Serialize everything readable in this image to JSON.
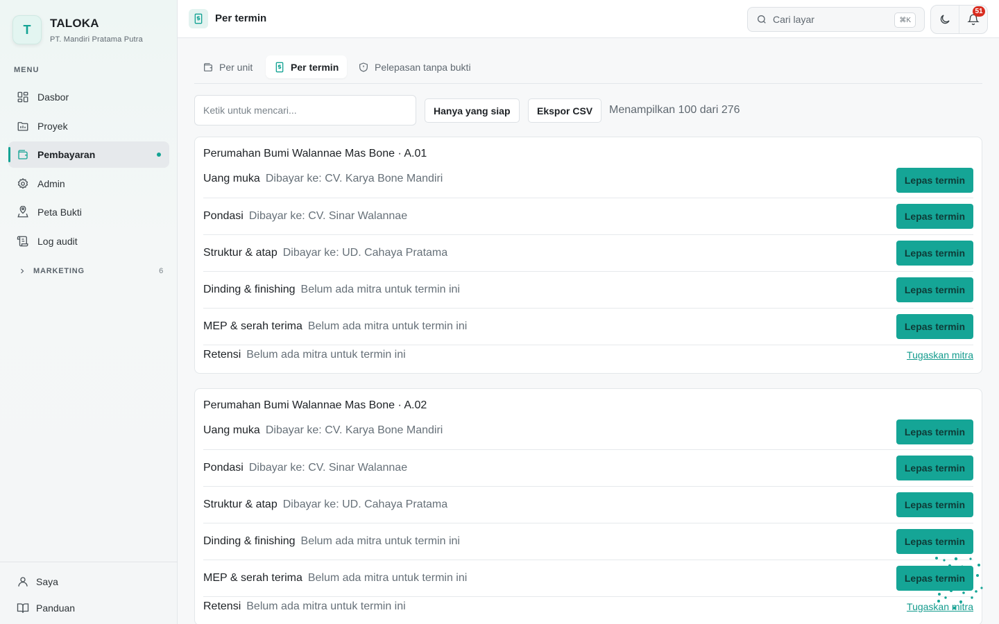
{
  "brand": {
    "logo_letter": "T",
    "name": "TALOKA",
    "company": "PT. Mandiri Pratama Putra"
  },
  "sidebar": {
    "menu_label": "MENU",
    "items": [
      {
        "label": "Dasbor",
        "icon": "dashboard-icon"
      },
      {
        "label": "Proyek",
        "icon": "folder-icon"
      },
      {
        "label": "Pembayaran",
        "icon": "wallet-icon",
        "active": true
      },
      {
        "label": "Admin",
        "icon": "gear-icon"
      },
      {
        "label": "Peta Bukti",
        "icon": "map-pin-icon"
      },
      {
        "label": "Log audit",
        "icon": "scroll-icon"
      }
    ],
    "marketing": {
      "label": "MARKETING",
      "count": "6"
    },
    "footer": [
      {
        "label": "Saya",
        "icon": "user-icon"
      },
      {
        "label": "Panduan",
        "icon": "book-icon"
      }
    ]
  },
  "header": {
    "title": "Per termin",
    "search_placeholder": "Cari layar",
    "shortcut": "⌘K",
    "notification_count": "51"
  },
  "tabs": [
    {
      "label": "Per unit",
      "icon": "wallet-icon"
    },
    {
      "label": "Per termin",
      "icon": "receipt-icon",
      "active": true
    },
    {
      "label": "Pelepasan tanpa bukti",
      "icon": "shield-icon"
    }
  ],
  "toolbar": {
    "search_placeholder": "Ketik untuk mencari...",
    "ready_only_label": "Hanya yang siap",
    "export_label": "Ekspor CSV",
    "showing_text": "Menampilkan 100 dari 276"
  },
  "actions": {
    "release_label": "Lepas termin",
    "assign_label": "Tugaskan mitra"
  },
  "units": [
    {
      "title": "Perumahan Bumi Walannae Mas Bone · A.01",
      "terms": [
        {
          "name": "Uang muka",
          "payee": "Dibayar ke: CV. Karya Bone Mandiri",
          "action": "release"
        },
        {
          "name": "Pondasi",
          "payee": "Dibayar ke: CV. Sinar Walannae",
          "action": "release"
        },
        {
          "name": "Struktur & atap",
          "payee": "Dibayar ke: UD. Cahaya Pratama",
          "action": "release"
        },
        {
          "name": "Dinding & finishing",
          "payee": "Belum ada mitra untuk termin ini",
          "action": "release"
        },
        {
          "name": "MEP & serah terima",
          "payee": "Belum ada mitra untuk termin ini",
          "action": "release"
        },
        {
          "name": "Retensi",
          "payee": "Belum ada mitra untuk termin ini",
          "action": "assign"
        }
      ]
    },
    {
      "title": "Perumahan Bumi Walannae Mas Bone · A.02",
      "terms": [
        {
          "name": "Uang muka",
          "payee": "Dibayar ke: CV. Karya Bone Mandiri",
          "action": "release"
        },
        {
          "name": "Pondasi",
          "payee": "Dibayar ke: CV. Sinar Walannae",
          "action": "release"
        },
        {
          "name": "Struktur & atap",
          "payee": "Dibayar ke: UD. Cahaya Pratama",
          "action": "release"
        },
        {
          "name": "Dinding & finishing",
          "payee": "Belum ada mitra untuk termin ini",
          "action": "release"
        },
        {
          "name": "MEP & serah terima",
          "payee": "Belum ada mitra untuk termin ini",
          "action": "release"
        },
        {
          "name": "Retensi",
          "payee": "Belum ada mitra untuk termin ini",
          "action": "assign"
        }
      ]
    }
  ],
  "colors": {
    "accent": "#15a596",
    "badge": "#d92d20"
  }
}
